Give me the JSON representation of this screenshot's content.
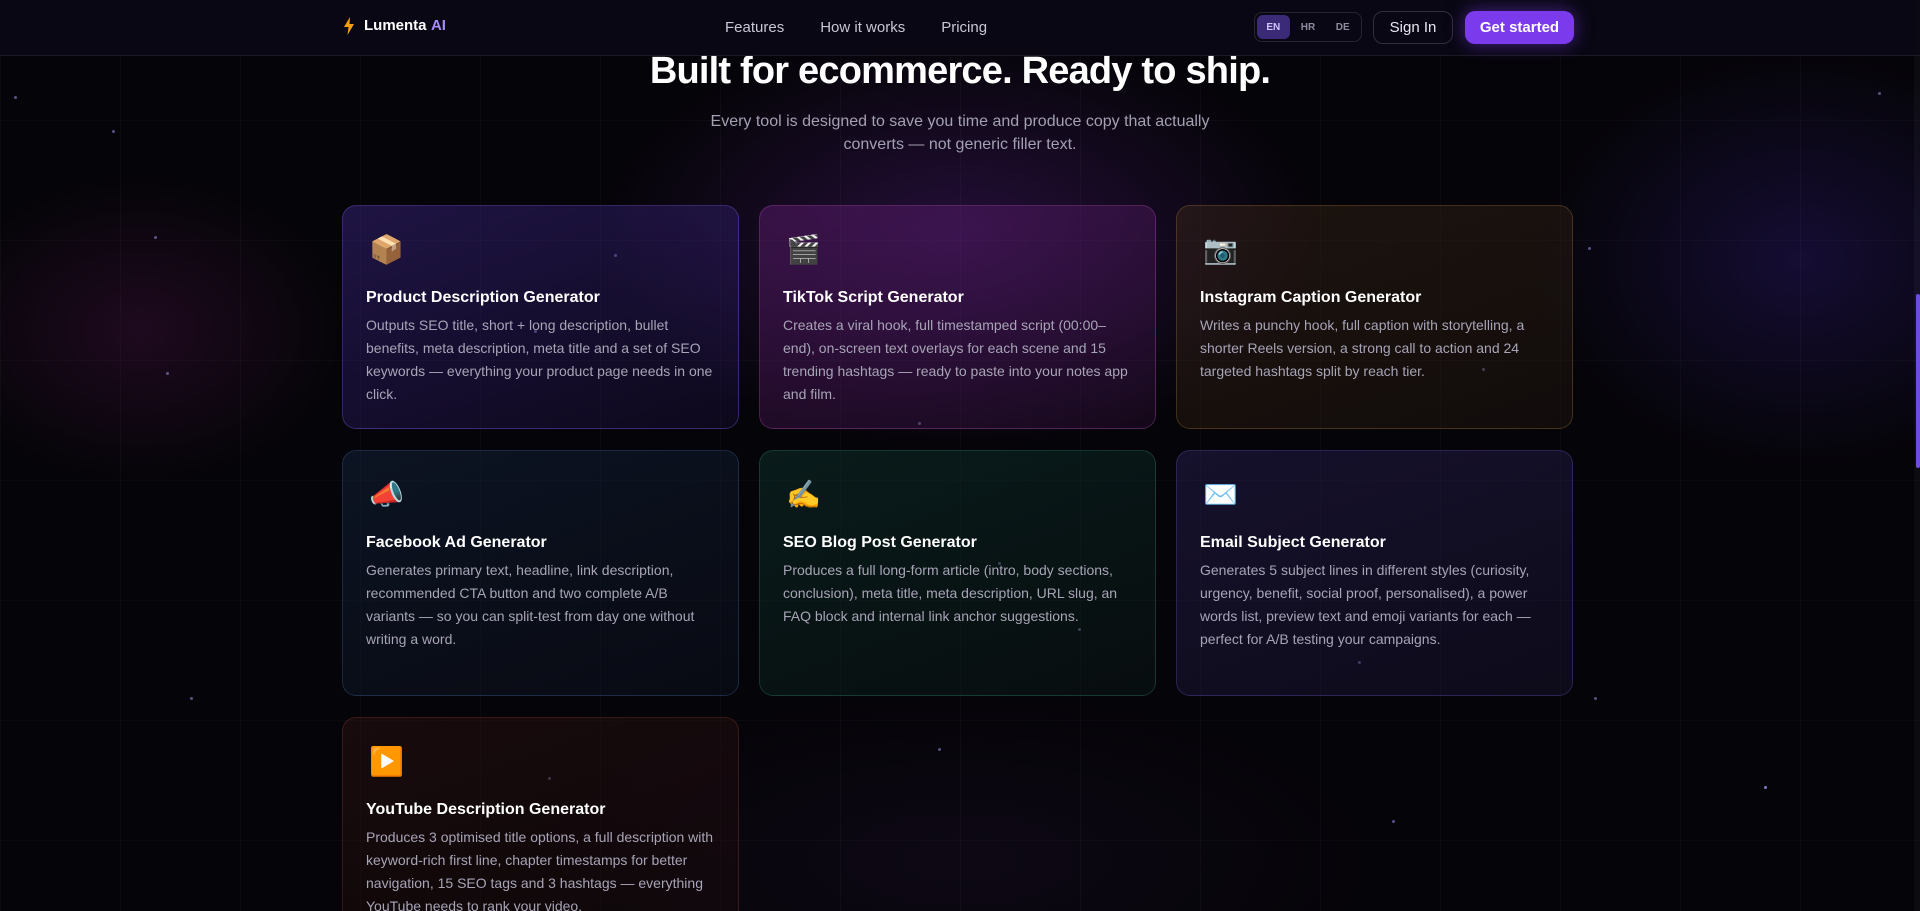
{
  "nav": {
    "brand": "Lumenta",
    "brand_accent": "AI",
    "links": [
      "Features",
      "How it works",
      "Pricing"
    ],
    "languages": [
      "EN",
      "HR",
      "DE"
    ],
    "active_language": "EN",
    "signin_label": "Sign In",
    "cta_label": "Get started"
  },
  "hero": {
    "title": "Built for ecommerce. Ready to ship.",
    "subtitle": "Every tool is designed to save you time and produce copy that actually converts — not generic filler text."
  },
  "cards": [
    {
      "icon": "📦",
      "icon_name": "package-icon",
      "title": "Product Description Generator",
      "desc": "Outputs SEO title, short + long description, bullet benefits, meta description, meta title and a set of SEO keywords — everything your product page needs in one click."
    },
    {
      "icon": "🎬",
      "icon_name": "clapperboard-icon",
      "title": "TikTok Script Generator",
      "desc": "Creates a viral hook, full timestamped script (00:00–end), on-screen text overlays for each scene and 15 trending hashtags — ready to paste into your notes app and film."
    },
    {
      "icon": "📷",
      "icon_name": "camera-icon",
      "title": "Instagram Caption Generator",
      "desc": "Writes a punchy hook, full caption with storytelling, a shorter Reels version, a strong call to action and 24 targeted hashtags split by reach tier."
    },
    {
      "icon": "📣",
      "icon_name": "megaphone-icon",
      "title": "Facebook Ad Generator",
      "desc": "Generates primary text, headline, link description, recommended CTA button and two complete A/B variants — so you can split-test from day one without writing a word."
    },
    {
      "icon": "✍️",
      "icon_name": "writing-hand-icon",
      "title": "SEO Blog Post Generator",
      "desc": "Produces a full long-form article (intro, body sections, conclusion), meta title, meta description, URL slug, an FAQ block and internal link anchor suggestions."
    },
    {
      "icon": "✉️",
      "icon_name": "envelope-icon",
      "title": "Email Subject Generator",
      "desc": "Generates 5 subject lines in different styles (curiosity, urgency, benefit, social proof, personalised), a power words list, preview text and emoji variants for each — perfect for A/B testing your campaigns."
    },
    {
      "icon": "▶️",
      "icon_name": "play-button-icon",
      "title": "YouTube Description Generator",
      "desc": "Produces 3 optimised title options, a full description with keyword-rich first line, chapter timestamps for better navigation, 15 SEO tags and 3 hashtags — everything YouTube needs to rank your video."
    }
  ],
  "colors": {
    "accent": "#7c3aed",
    "brand_accent": "#a78bfa",
    "background": "#050408"
  }
}
